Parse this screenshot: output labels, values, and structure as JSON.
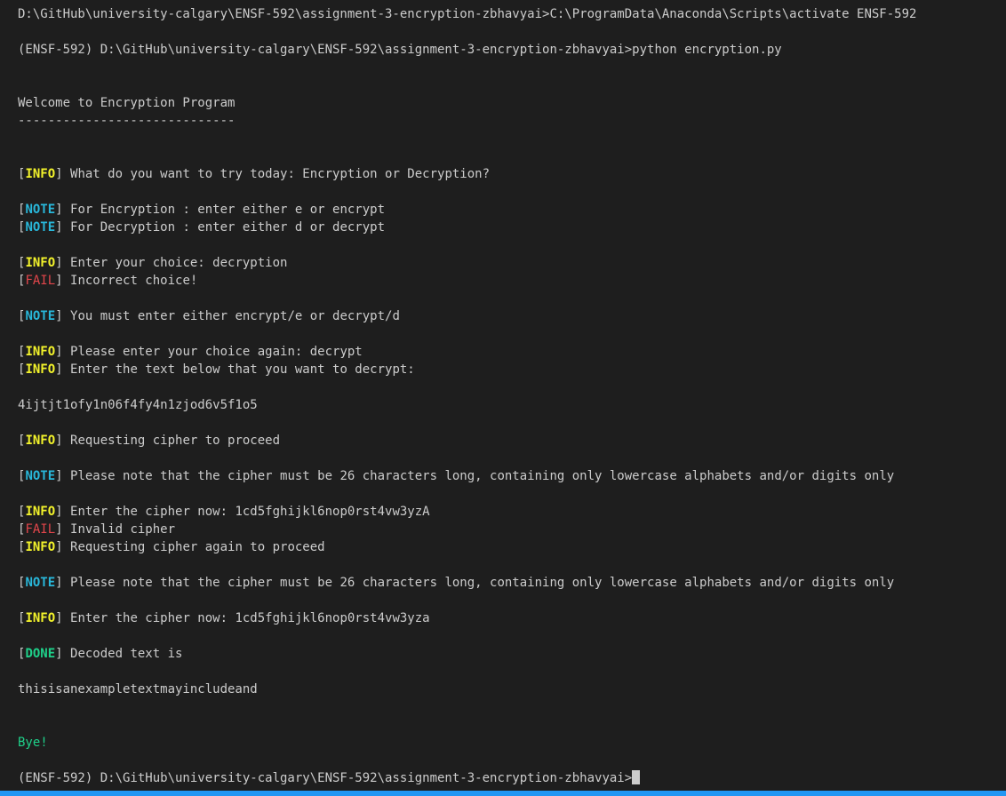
{
  "terminal": {
    "background_color": "#1e1e1e",
    "foreground_color": "#cccccc",
    "bottom_bar_color": "#2196f3",
    "tag_colors": {
      "INFO": "#f3f32b",
      "NOTE": "#29b8db",
      "FAIL": "#e2464b",
      "DONE": "#1fd18a",
      "BYE": "#1fd18a"
    },
    "cursor": "block-cursor"
  },
  "lines": [
    {
      "id": "line-activate-command",
      "kind": "prompt",
      "text": "D:\\GitHub\\university-calgary\\ENSF-592\\assignment-3-encryption-zbhavyai>C:\\ProgramData\\Anaconda\\Scripts\\activate ENSF-592"
    },
    {
      "id": "line-blank-1",
      "kind": "blank",
      "text": " "
    },
    {
      "id": "line-python-command",
      "kind": "prompt",
      "text": "(ENSF-592) D:\\GitHub\\university-calgary\\ENSF-592\\assignment-3-encryption-zbhavyai>python encryption.py"
    },
    {
      "id": "line-blank-2",
      "kind": "blank",
      "text": " "
    },
    {
      "id": "line-blank-3",
      "kind": "blank",
      "text": " "
    },
    {
      "id": "line-welcome-title",
      "kind": "plain",
      "text": "Welcome to Encryption Program"
    },
    {
      "id": "line-welcome-underline",
      "kind": "plain",
      "text": "-----------------------------"
    },
    {
      "id": "line-blank-4",
      "kind": "blank",
      "text": " "
    },
    {
      "id": "line-blank-5",
      "kind": "blank",
      "text": " "
    },
    {
      "id": "line-info-what-do-you-want",
      "kind": "tagged",
      "tag": "INFO",
      "text": "What do you want to try today: Encryption or Decryption?"
    },
    {
      "id": "line-blank-6",
      "kind": "blank",
      "text": " "
    },
    {
      "id": "line-note-for-encryption",
      "kind": "tagged",
      "tag": "NOTE",
      "text": "For Encryption : enter either e or encrypt"
    },
    {
      "id": "line-note-for-decryption",
      "kind": "tagged",
      "tag": "NOTE",
      "text": "For Decryption : enter either d or decrypt"
    },
    {
      "id": "line-blank-7",
      "kind": "blank",
      "text": " "
    },
    {
      "id": "line-info-enter-your-choice",
      "kind": "tagged",
      "tag": "INFO",
      "text": "Enter your choice: decryption"
    },
    {
      "id": "line-fail-incorrect-choice",
      "kind": "tagged",
      "tag": "FAIL",
      "text": "Incorrect choice!"
    },
    {
      "id": "line-blank-8",
      "kind": "blank",
      "text": " "
    },
    {
      "id": "line-note-must-enter-either",
      "kind": "tagged",
      "tag": "NOTE",
      "text": "You must enter either encrypt/e or decrypt/d"
    },
    {
      "id": "line-blank-9",
      "kind": "blank",
      "text": " "
    },
    {
      "id": "line-info-choice-again",
      "kind": "tagged",
      "tag": "INFO",
      "text": "Please enter your choice again: decrypt"
    },
    {
      "id": "line-info-enter-text-below",
      "kind": "tagged",
      "tag": "INFO",
      "text": "Enter the text below that you want to decrypt:"
    },
    {
      "id": "line-blank-10",
      "kind": "blank",
      "text": " "
    },
    {
      "id": "line-encrypted-input",
      "kind": "plain",
      "text": "4ijtjt1ofy1n06f4fy4n1zjod6v5f1o5"
    },
    {
      "id": "line-blank-11",
      "kind": "blank",
      "text": " "
    },
    {
      "id": "line-info-requesting-cipher",
      "kind": "tagged",
      "tag": "INFO",
      "text": "Requesting cipher to proceed"
    },
    {
      "id": "line-blank-12",
      "kind": "blank",
      "text": " "
    },
    {
      "id": "line-note-cipher-rules-1",
      "kind": "tagged",
      "tag": "NOTE",
      "text": "Please note that the cipher must be 26 characters long, containing only lowercase alphabets and/or digits only"
    },
    {
      "id": "line-blank-13",
      "kind": "blank",
      "text": " "
    },
    {
      "id": "line-info-enter-cipher-1",
      "kind": "tagged",
      "tag": "INFO",
      "text": "Enter the cipher now: 1cd5fghijkl6nop0rst4vw3yzA"
    },
    {
      "id": "line-fail-invalid-cipher",
      "kind": "tagged",
      "tag": "FAIL",
      "text": "Invalid cipher"
    },
    {
      "id": "line-info-requesting-cipher-again",
      "kind": "tagged",
      "tag": "INFO",
      "text": "Requesting cipher again to proceed"
    },
    {
      "id": "line-blank-14",
      "kind": "blank",
      "text": " "
    },
    {
      "id": "line-note-cipher-rules-2",
      "kind": "tagged",
      "tag": "NOTE",
      "text": "Please note that the cipher must be 26 characters long, containing only lowercase alphabets and/or digits only"
    },
    {
      "id": "line-blank-15",
      "kind": "blank",
      "text": " "
    },
    {
      "id": "line-info-enter-cipher-2",
      "kind": "tagged",
      "tag": "INFO",
      "text": "Enter the cipher now: 1cd5fghijkl6nop0rst4vw3yza"
    },
    {
      "id": "line-blank-16",
      "kind": "blank",
      "text": " "
    },
    {
      "id": "line-done-decoded-text-is",
      "kind": "tagged",
      "tag": "DONE",
      "text": "Decoded text is"
    },
    {
      "id": "line-blank-17",
      "kind": "blank",
      "text": " "
    },
    {
      "id": "line-decoded-output",
      "kind": "plain",
      "text": "thisisanexampletextmayincludeand"
    },
    {
      "id": "line-blank-18",
      "kind": "blank",
      "text": " "
    },
    {
      "id": "line-blank-19",
      "kind": "blank",
      "text": " "
    },
    {
      "id": "line-bye",
      "kind": "bye",
      "text": "Bye!"
    },
    {
      "id": "line-blank-20",
      "kind": "blank",
      "text": " "
    },
    {
      "id": "line-final-prompt",
      "kind": "prompt-cursor",
      "text": "(ENSF-592) D:\\GitHub\\university-calgary\\ENSF-592\\assignment-3-encryption-zbhavyai>"
    }
  ]
}
